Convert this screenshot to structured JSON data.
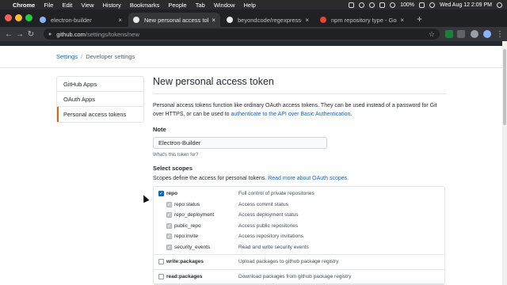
{
  "menubar": {
    "apple": "",
    "items": [
      "Chrome",
      "File",
      "Edit",
      "View",
      "History",
      "Bookmarks",
      "People",
      "Tab",
      "Window",
      "Help"
    ],
    "battery": "100%",
    "clock": "Wed Aug 12  2:09 PM"
  },
  "tabs": [
    {
      "title": "electron-builder",
      "favicon_color": "#8ab4f8"
    },
    {
      "title": "New personal access token",
      "favicon_color": "#e8eaed"
    },
    {
      "title": "beyondcode/regexpress-build",
      "favicon_color": "#e8eaed"
    },
    {
      "title": "npm repository type - Google",
      "favicon_color": "#ea4335"
    }
  ],
  "address": {
    "host": "github.com",
    "path": "/settings/tokens/new"
  },
  "breadcrumb": {
    "settings": "Settings",
    "separator": "/",
    "current": "Developer settings"
  },
  "sidebar": {
    "items": [
      {
        "label": "GitHub Apps"
      },
      {
        "label": "OAuth Apps"
      },
      {
        "label": "Personal access tokens"
      }
    ]
  },
  "main": {
    "title": "New personal access token",
    "intro_text": "Personal access tokens function like ordinary OAuth access tokens. They can be used instead of a password for Git over HTTPS, or can be used to ",
    "intro_link": "authenticate to the API over Basic Authentication",
    "intro_end": ".",
    "note_label": "Note",
    "note_value": "Electron-Builder",
    "note_hint": "What's this token for?",
    "scopes_label": "Select scopes",
    "scopes_desc": "Scopes define the access for personal tokens. ",
    "scopes_link": "Read more about OAuth scopes.",
    "scopes": [
      {
        "name": "repo",
        "desc": "Full control of private repositories",
        "checked": true,
        "children": [
          {
            "name": "repo:status",
            "desc": "Access commit status"
          },
          {
            "name": "repo_deployment",
            "desc": "Access deployment status"
          },
          {
            "name": "public_repo",
            "desc": "Access public repositories"
          },
          {
            "name": "repo:invite",
            "desc": "Access repository invitations"
          },
          {
            "name": "security_events",
            "desc": "Read and write security events"
          }
        ]
      },
      {
        "name": "write:packages",
        "desc": "Upload packages to github package registry",
        "checked": false,
        "children": []
      },
      {
        "name": "read:packages",
        "desc": "Download packages from github package registry",
        "checked": false,
        "children": []
      }
    ]
  },
  "colors": {
    "accent": "#0366d6",
    "selected_nav": "#e36209",
    "chrome_dark": "#202124"
  }
}
